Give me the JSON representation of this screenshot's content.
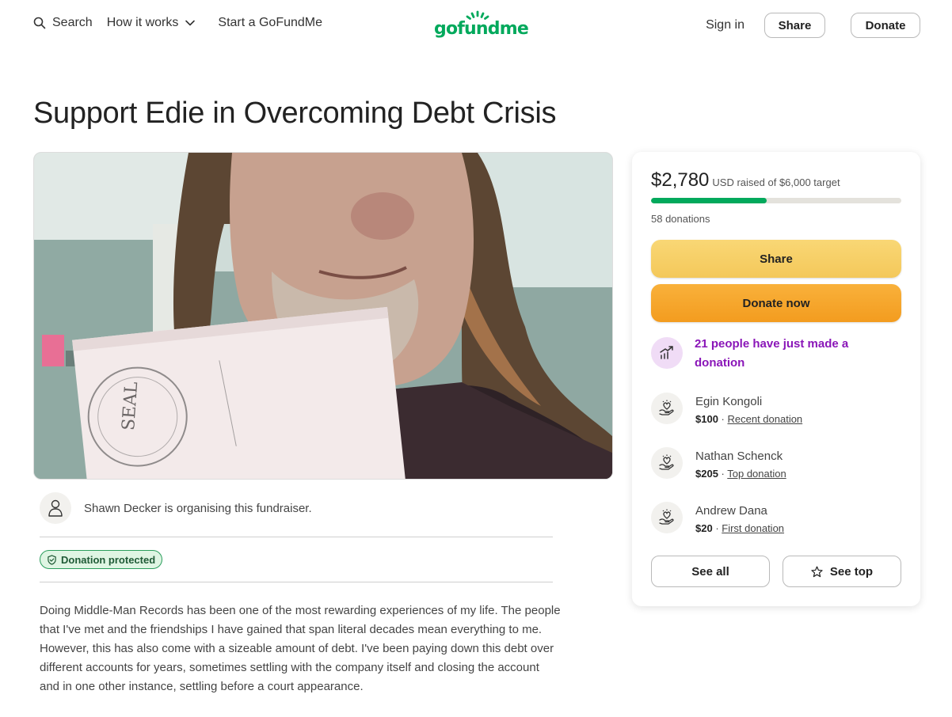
{
  "header": {
    "search_label": "Search",
    "how_it_works_label": "How it works",
    "start_label": "Start a GoFundMe",
    "logo_text": "gofundme",
    "sign_in_label": "Sign in",
    "share_label": "Share",
    "donate_label": "Donate"
  },
  "campaign": {
    "title": "Support Edie in Overcoming Debt Crisis",
    "organiser_text": "Shawn Decker is organising this fundraiser.",
    "protected_badge": "Donation protected",
    "story": "Doing Middle-Man Records has been one of the most rewarding experiences of my life. The people that I've met and the friendships I have gained that span literal decades mean everything to me. However, this has also come with a sizeable amount of debt. I've been paying down this debt over different accounts for years, sometimes settling with the company itself and closing the account and in one other instance, settling before a court appearance."
  },
  "hero_image": {
    "book_text": "SEAL"
  },
  "card": {
    "amount_raised": "$2,780",
    "amount_sub": "USD raised of $6,000 target",
    "progress_fraction": 0.463,
    "donations_count": "58 donations",
    "share_button": "Share",
    "donate_button": "Donate now",
    "trending_text": "21 people have just made a donation",
    "donors": [
      {
        "name": "Egin Kongoli",
        "amount": "$100",
        "tag": "Recent donation"
      },
      {
        "name": "Nathan Schenck",
        "amount": "$205",
        "tag": "Top donation"
      },
      {
        "name": "Andrew Dana",
        "amount": "$20",
        "tag": "First donation"
      }
    ],
    "see_all_button": "See all",
    "see_top_button": "See top"
  },
  "colors": {
    "brand_green": "#02a95c",
    "share_yellow": "#f4c85a",
    "donate_orange": "#f39c1f",
    "trending_purple": "#8a16b8"
  }
}
